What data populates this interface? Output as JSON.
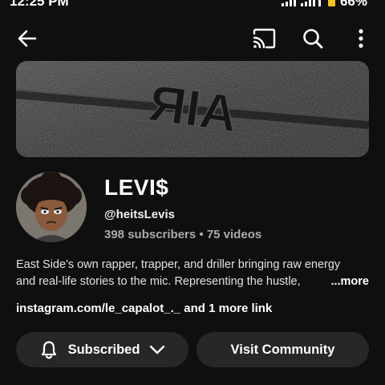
{
  "status_bar": {
    "time": "12:25 PM",
    "battery": "66%"
  },
  "top_bar": {
    "icons": [
      "back-arrow-icon",
      "cast-icon",
      "search-icon",
      "more-vertical-icon"
    ]
  },
  "banner": {
    "text": "AIR"
  },
  "channel": {
    "name": "LEVI$",
    "handle": "@heitsLevis",
    "stats": "398 subscribers • 75 videos"
  },
  "description": {
    "line1": "East Side's own rapper, trapper, and driller bringing raw energy",
    "line2": "and real-life stories to the mic. Representing the hustle,",
    "more_label": "...more"
  },
  "links": {
    "url": "instagram.com/le_capalot_._",
    "more": " and 1 more link"
  },
  "actions": {
    "subscribed_label": "Subscribed",
    "community_label": "Visit Community"
  },
  "colors": {
    "background": "#0f0f0f",
    "button_bg": "#272727",
    "secondary_text": "#aaaaaa",
    "battery": "#f5c518"
  }
}
